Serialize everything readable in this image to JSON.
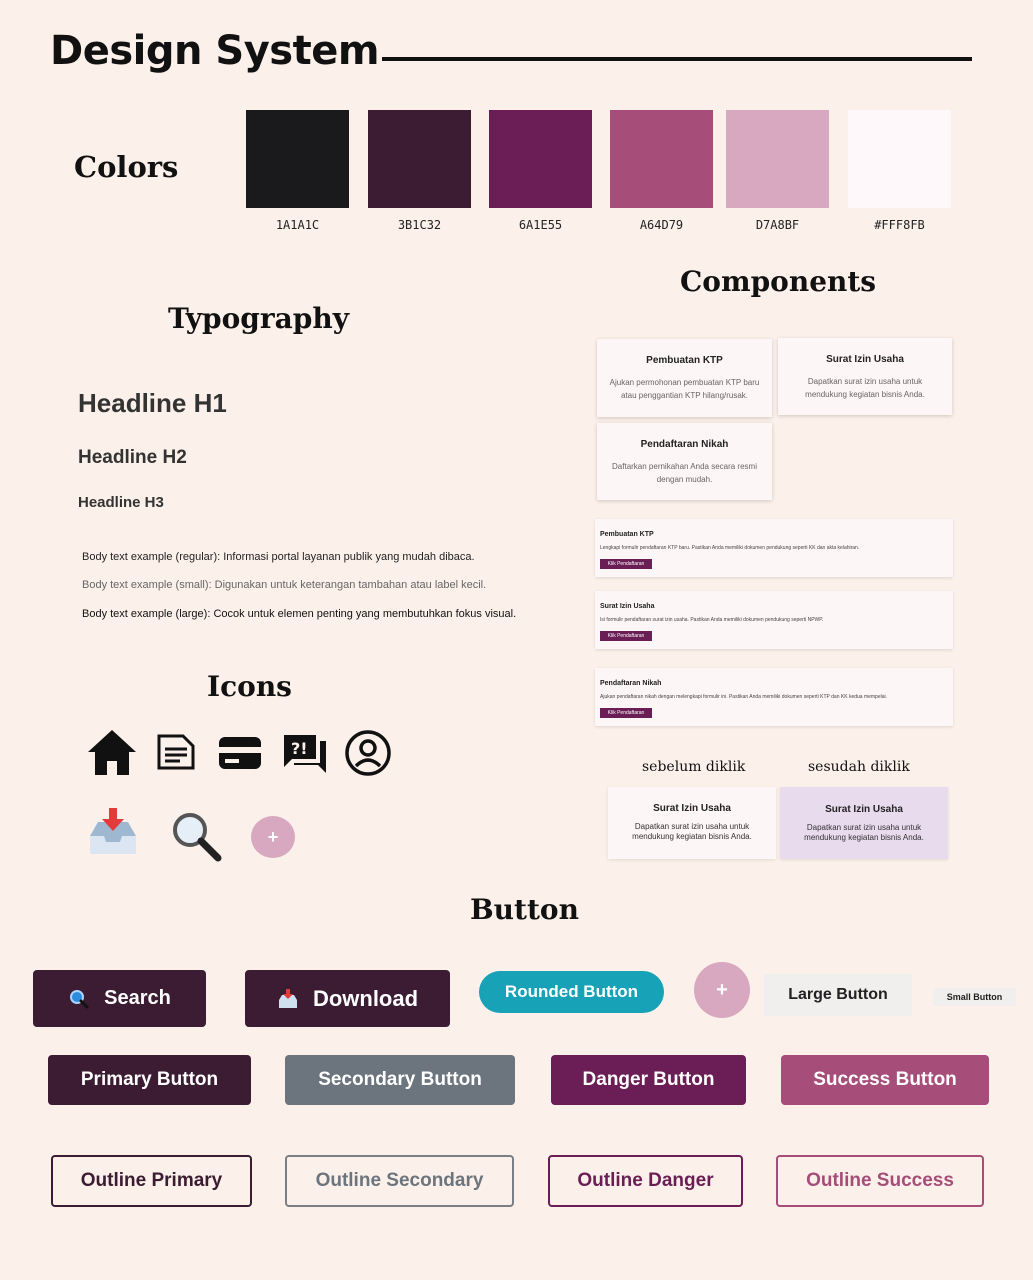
{
  "header": {
    "title": "Design System"
  },
  "colors": {
    "heading": "Colors",
    "swatches": [
      {
        "hex": "#1A1A1C",
        "label": "1A1A1C"
      },
      {
        "hex": "#3B1C32",
        "label": "3B1C32"
      },
      {
        "hex": "#6A1E55",
        "label": "6A1E55"
      },
      {
        "hex": "#A64D79",
        "label": "A64D79"
      },
      {
        "hex": "#D7A8BF",
        "label": "D7A8BF"
      },
      {
        "hex": "#FFF8FB",
        "label": "#FFF8FB"
      }
    ]
  },
  "typography": {
    "heading": "Typography",
    "h1": "Headline H1",
    "h2": "Headline H2",
    "h3": "Headline H3",
    "body_regular": "Body text example (regular): Informasi portal layanan publik yang mudah dibaca.",
    "body_small": "Body text example (small): Digunakan untuk keterangan tambahan atau label kecil.",
    "body_large": "Body text example (large): Cocok untuk elemen penting yang membutuhkan fokus visual."
  },
  "icons": {
    "heading": "Icons",
    "items": [
      "home-icon",
      "document-icon",
      "credit-card-icon",
      "feedback-chat-icon",
      "user-circle-icon",
      "inbox-download-icon",
      "magnifier-icon",
      "plus-fab-icon"
    ],
    "plus_symbol": "+"
  },
  "components": {
    "heading": "Components",
    "cards": [
      {
        "title": "Pembuatan KTP",
        "desc": "Ajukan permohonan pembuatan KTP baru atau penggantian KTP hilang/rusak."
      },
      {
        "title": "Surat Izin Usaha",
        "desc": "Dapatkan surat izin usaha untuk mendukung kegiatan bisnis Anda."
      },
      {
        "title": "Pendaftaran Nikah",
        "desc": "Daftarkan pernikahan Anda secara resmi dengan mudah."
      }
    ],
    "rows": [
      {
        "title": "Pembuatan KTP",
        "desc": "Lengkapi formulir pendaftaran KTP baru. Pastikan Anda memiliki dokumen pendukung seperti KK dan akta kelahiran.",
        "button": "Klik Pendaftaran"
      },
      {
        "title": "Surat Izin Usaha",
        "desc": "Isi formulir pendaftaran surat izin usaha. Pastikan Anda memiliki dokumen pendukung seperti NPWP.",
        "button": "Klik Pendaftaran"
      },
      {
        "title": "Pendaftaran Nikah",
        "desc": "Ajukan pendaftaran nikah dengan melengkapi formulir ini. Pastikan Anda memiliki dokumen seperti KTP dan KK kedua mempelai.",
        "button": "Klik Pendaftaran"
      }
    ],
    "before_label": "sebelum diklik",
    "after_label": "sesudah diklik",
    "state_card": {
      "title": "Surat Izin Usaha",
      "desc": "Dapatkan surat izin usaha untuk mendukung kegiatan bisnis Anda."
    }
  },
  "buttons": {
    "heading": "Button",
    "search": "Search",
    "download": "Download",
    "rounded": "Rounded Button",
    "fab": "+",
    "large": "Large Button",
    "small": "Small Button",
    "primary": "Primary Button",
    "secondary": "Secondary Button",
    "danger": "Danger Button",
    "success": "Success Button",
    "outline_primary": "Outline Primary",
    "outline_secondary": "Outline Secondary",
    "outline_danger": "Outline Danger",
    "outline_success": "Outline Success"
  }
}
